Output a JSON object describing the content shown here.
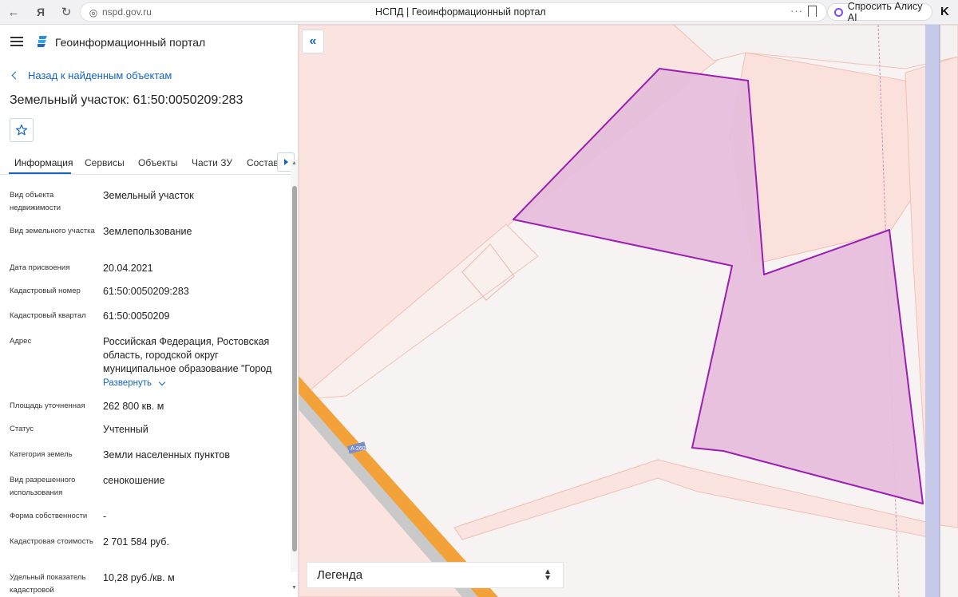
{
  "browser": {
    "url": "nspd.gov.ru",
    "tab_title": "НСПД | Геоинформационный портал",
    "alice_label": "Спросить Алису AI"
  },
  "header": {
    "portal_title": "Геоинформационный портал"
  },
  "navigation": {
    "back_label": "Назад к найденным объектам"
  },
  "object": {
    "title": "Земельный участок: 61:50:0050209:283"
  },
  "tabs": [
    {
      "label": "Информация",
      "active": true
    },
    {
      "label": "Сервисы",
      "active": false
    },
    {
      "label": "Объекты",
      "active": false
    },
    {
      "label": "Части ЗУ",
      "active": false
    },
    {
      "label": "Состав",
      "active": false
    }
  ],
  "properties": [
    {
      "label": "Вид объекта недвижимости",
      "value": "Земельный участок"
    },
    {
      "label": "Вид земельного участка",
      "value": "Землепользование"
    },
    {
      "label": "Дата присвоения",
      "value": "20.04.2021"
    },
    {
      "label": "Кадастровый номер",
      "value": "61:50:0050209:283"
    },
    {
      "label": "Кадастровый квартал",
      "value": "61:50:0050209"
    },
    {
      "label": "Адрес",
      "value": "Российская Федерация, Ростовская область, городской округ муниципальное образование \"Город",
      "expand_label": "Развернуть"
    },
    {
      "label": "Площадь уточненная",
      "value": "262 800 кв. м"
    },
    {
      "label": "Статус",
      "value": "Учтенный"
    },
    {
      "label": "Категория земель",
      "value": "Земли населенных пунктов"
    },
    {
      "label": "Вид разрешенного использования",
      "value": "сенокошение"
    },
    {
      "label": "Форма собственности",
      "value": "-"
    },
    {
      "label": "Кадастровая стоимость",
      "value": "2 701 584 руб."
    },
    {
      "label": "Удельный показатель кадастровой",
      "value": "10,28 руб./кв. м"
    }
  ],
  "map": {
    "legend_label": "Легенда",
    "road_label": "А-260",
    "parcel_color": "#e6bedb",
    "parcel_stroke": "#9b1fb0"
  }
}
